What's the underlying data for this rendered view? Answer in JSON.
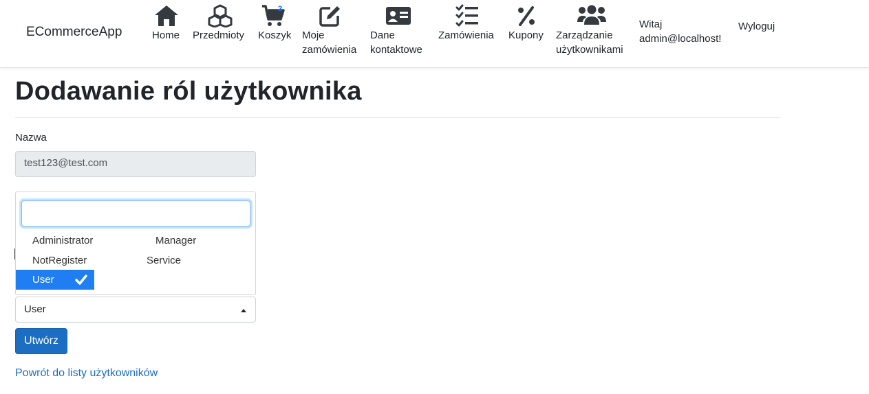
{
  "nav": {
    "brand": "ECommerceApp",
    "items": [
      {
        "icon": "home-icon",
        "label": "Home"
      },
      {
        "icon": "cubes-icon",
        "label": "Przedmioty"
      },
      {
        "icon": "cart-icon",
        "label": "Koszyk",
        "badge": "2"
      },
      {
        "icon": "edit-icon",
        "label": "Moje\nzamówienia"
      },
      {
        "icon": "contact-card-icon",
        "label": "Dane\nkontaktowe"
      },
      {
        "icon": "tasks-icon",
        "label": "Zamówienia"
      },
      {
        "icon": "percent-icon",
        "label": "Kupony"
      },
      {
        "icon": "users-icon",
        "label": "Zarządzanie\nużytkownikami"
      }
    ],
    "greeting": "Witaj\nadmin@localhost!",
    "logout": "Wyloguj"
  },
  "page": {
    "title": "Dodawanie ról użytkownika",
    "name_label": "Nazwa",
    "name_value": "test123@test.com"
  },
  "roles_dropdown": {
    "search_value": "",
    "options": [
      "Administrator",
      "Manager",
      "NotRegister",
      "Service",
      "User"
    ],
    "selected": "User"
  },
  "roles_select": {
    "value": "User"
  },
  "actions": {
    "create_label": "Utwórz",
    "back_link": "Powrót do listy użytkowników"
  },
  "colors": {
    "accent": "#1b6ec2",
    "selected": "#1f7ef2"
  }
}
